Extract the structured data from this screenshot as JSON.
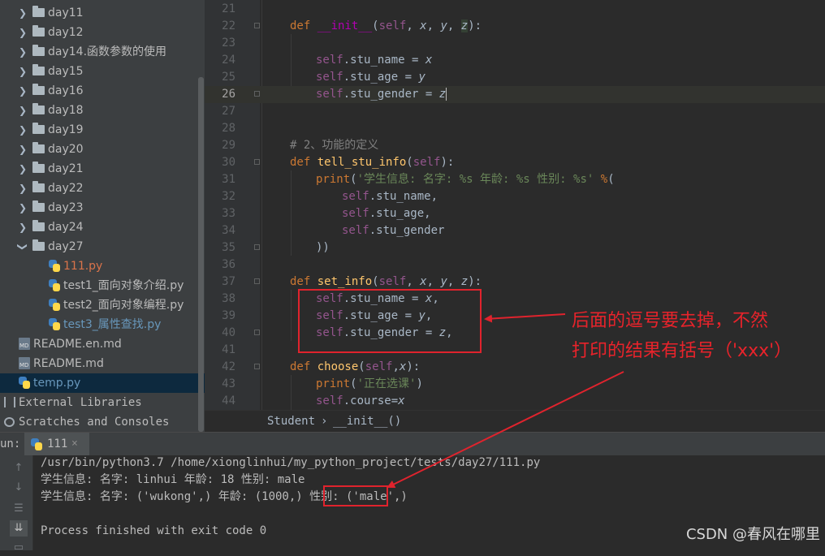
{
  "project_tree": {
    "items": [
      {
        "label": "day11",
        "type": "folder"
      },
      {
        "label": "day12",
        "type": "folder"
      },
      {
        "label": "day14.函数参数的使用",
        "type": "folder"
      },
      {
        "label": "day15",
        "type": "folder"
      },
      {
        "label": "day16",
        "type": "folder"
      },
      {
        "label": "day18",
        "type": "folder"
      },
      {
        "label": "day19",
        "type": "folder"
      },
      {
        "label": "day20",
        "type": "folder"
      },
      {
        "label": "day21",
        "type": "folder"
      },
      {
        "label": "day22",
        "type": "folder"
      },
      {
        "label": "day23",
        "type": "folder"
      },
      {
        "label": "day24",
        "type": "folder"
      },
      {
        "label": "day27",
        "type": "folder-open"
      },
      {
        "label": "111.py",
        "type": "py",
        "color": "#d9734a"
      },
      {
        "label": "test1_面向对象介绍.py",
        "type": "py",
        "color": "#bbbbbb"
      },
      {
        "label": "test2_面向对象编程.py",
        "type": "py",
        "color": "#bbbbbb"
      },
      {
        "label": "test3_属性查找.py",
        "type": "py",
        "color": "#6897bb"
      },
      {
        "label": "README.en.md",
        "type": "md"
      },
      {
        "label": "README.md",
        "type": "md"
      },
      {
        "label": "temp.py",
        "type": "py",
        "color": "#6897bb"
      },
      {
        "label": "External Libraries",
        "type": "libs"
      },
      {
        "label": "Scratches and Consoles",
        "type": "scratch"
      }
    ]
  },
  "editor": {
    "line_numbers": [
      "21",
      "22",
      "23",
      "24",
      "25",
      "26",
      "27",
      "28",
      "29",
      "30",
      "31",
      "32",
      "33",
      "34",
      "35",
      "36",
      "37",
      "38",
      "39",
      "40",
      "41",
      "42",
      "43",
      "44"
    ],
    "current_line": "26",
    "breadcrumb": {
      "class_name": "Student",
      "separator": "›",
      "method_name": "__init__()"
    }
  },
  "run_panel": {
    "label": "un:",
    "tab_name": "111",
    "tab_close": "×",
    "console_lines": [
      "/usr/bin/python3.7 /home/xionglinhui/my_python_project/tests/day27/111.py",
      "学生信息: 名字: linhui 年龄: 18 性别: male",
      "学生信息: 名字: ('wukong',) 年龄: (1000,) 性别: ('male',)",
      "",
      "Process finished with exit code 0"
    ]
  },
  "annotation": {
    "line1": "后面的逗号要去掉，不然",
    "line2": "打印的结果有括号（'xxx'）",
    "color": "#e8232b"
  },
  "watermark": "CSDN @春风在哪里",
  "colors": {
    "keyword": "#cc7832",
    "function": "#ffc66d",
    "self": "#94558d",
    "string": "#6a8759",
    "comment": "#808080",
    "annotation_red": "#e0232d"
  }
}
